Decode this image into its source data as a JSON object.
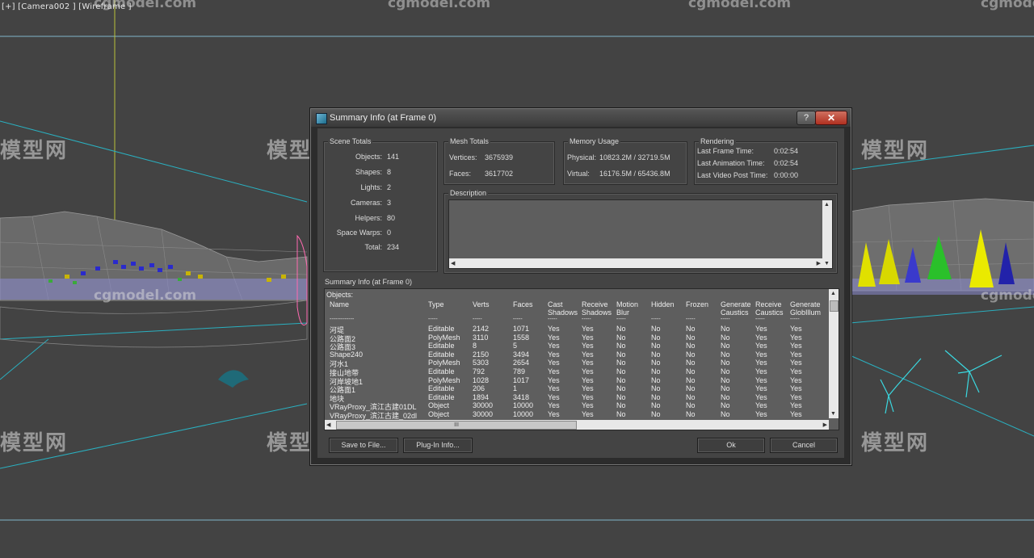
{
  "viewport": {
    "label": "[+] [Camera002 ] [Wireframe ]"
  },
  "watermarks": {
    "site": "cgmodel.com",
    "brand": "模型网"
  },
  "dialog": {
    "title": "Summary Info (at Frame 0)",
    "help": "?",
    "close": "✕",
    "scene_totals": {
      "title": "Scene Totals",
      "rows": [
        {
          "label": "Objects:",
          "value": "141"
        },
        {
          "label": "Shapes:",
          "value": "8"
        },
        {
          "label": "Lights:",
          "value": "2"
        },
        {
          "label": "Cameras:",
          "value": "3"
        },
        {
          "label": "Helpers:",
          "value": "80"
        },
        {
          "label": "Space Warps:",
          "value": "0"
        },
        {
          "label": "Total:",
          "value": "234"
        }
      ]
    },
    "mesh_totals": {
      "title": "Mesh Totals",
      "vertices_label": "Vertices:",
      "vertices": "3675939",
      "faces_label": "Faces:",
      "faces": "3617702"
    },
    "memory": {
      "title": "Memory Usage",
      "physical_label": "Physical:",
      "physical": "10823.2M / 32719.5M",
      "virtual_label": "Virtual:",
      "virtual": "16176.5M / 65436.8M"
    },
    "rendering": {
      "title": "Rendering",
      "rows": [
        {
          "label": "Last Frame Time:",
          "value": "0:02:54"
        },
        {
          "label": "Last Animation Time:",
          "value": "0:02:54"
        },
        {
          "label": "Last Video Post Time:",
          "value": "0:00:00"
        }
      ]
    },
    "description_title": "Description",
    "summary_title": "Summary Info (at Frame 0)",
    "objects_label": "Objects:",
    "columns": [
      [
        "",
        "Name"
      ],
      [
        "",
        "Type"
      ],
      [
        "",
        "Verts"
      ],
      [
        "",
        "Faces"
      ],
      [
        "Cast",
        "Shadows"
      ],
      [
        "Receive",
        "Shadows"
      ],
      [
        "Motion",
        "Blur"
      ],
      [
        "",
        "Hidden"
      ],
      [
        "",
        "Frozen"
      ],
      [
        "Generate",
        "Caustics"
      ],
      [
        "Receive",
        "Caustics"
      ],
      [
        "Generate",
        "GlobIllum"
      ]
    ],
    "dash_row": [
      "-------------",
      "-----",
      "-----",
      "-----",
      "-----",
      "-----",
      "-----",
      "-----",
      "-----",
      "-----",
      "-----",
      "-----"
    ],
    "rows": [
      [
        "河堤",
        "Editable",
        "2142",
        "1071",
        "Yes",
        "Yes",
        "No",
        "No",
        "No",
        "No",
        "Yes",
        "Yes"
      ],
      [
        "公路面2",
        "PolyMesh",
        "3110",
        "1558",
        "Yes",
        "Yes",
        "No",
        "No",
        "No",
        "No",
        "Yes",
        "Yes"
      ],
      [
        "公路面3",
        "Editable",
        "8",
        "5",
        "Yes",
        "Yes",
        "No",
        "No",
        "No",
        "No",
        "Yes",
        "Yes"
      ],
      [
        "Shape240",
        "Editable",
        "2150",
        "3494",
        "Yes",
        "Yes",
        "No",
        "No",
        "No",
        "No",
        "Yes",
        "Yes"
      ],
      [
        "河水1",
        "PolyMesh",
        "5303",
        "2654",
        "Yes",
        "Yes",
        "No",
        "No",
        "No",
        "No",
        "Yes",
        "Yes"
      ],
      [
        "接山地带",
        "Editable",
        "792",
        "789",
        "Yes",
        "Yes",
        "No",
        "No",
        "No",
        "No",
        "Yes",
        "Yes"
      ],
      [
        "河岸坡地1",
        "PolyMesh",
        "1028",
        "1017",
        "Yes",
        "Yes",
        "No",
        "No",
        "No",
        "No",
        "Yes",
        "Yes"
      ],
      [
        "公路面1",
        "Editable",
        "206",
        "1",
        "Yes",
        "Yes",
        "No",
        "No",
        "No",
        "No",
        "Yes",
        "Yes"
      ],
      [
        "地块",
        "Editable",
        "1894",
        "3418",
        "Yes",
        "Yes",
        "No",
        "No",
        "No",
        "No",
        "Yes",
        "Yes"
      ],
      [
        "VRayProxy_滨江古建01DL",
        "Object",
        "30000",
        "10000",
        "Yes",
        "Yes",
        "No",
        "No",
        "No",
        "No",
        "Yes",
        "Yes"
      ],
      [
        "VRayProxy_滨江古建_02dl",
        "Object",
        "30000",
        "10000",
        "Yes",
        "Yes",
        "No",
        "No",
        "No",
        "No",
        "Yes",
        "Yes"
      ]
    ],
    "scroll_grip": "III",
    "buttons": {
      "save": "Save to File...",
      "plugin": "Plug-In Info...",
      "ok": "Ok",
      "cancel": "Cancel"
    }
  }
}
